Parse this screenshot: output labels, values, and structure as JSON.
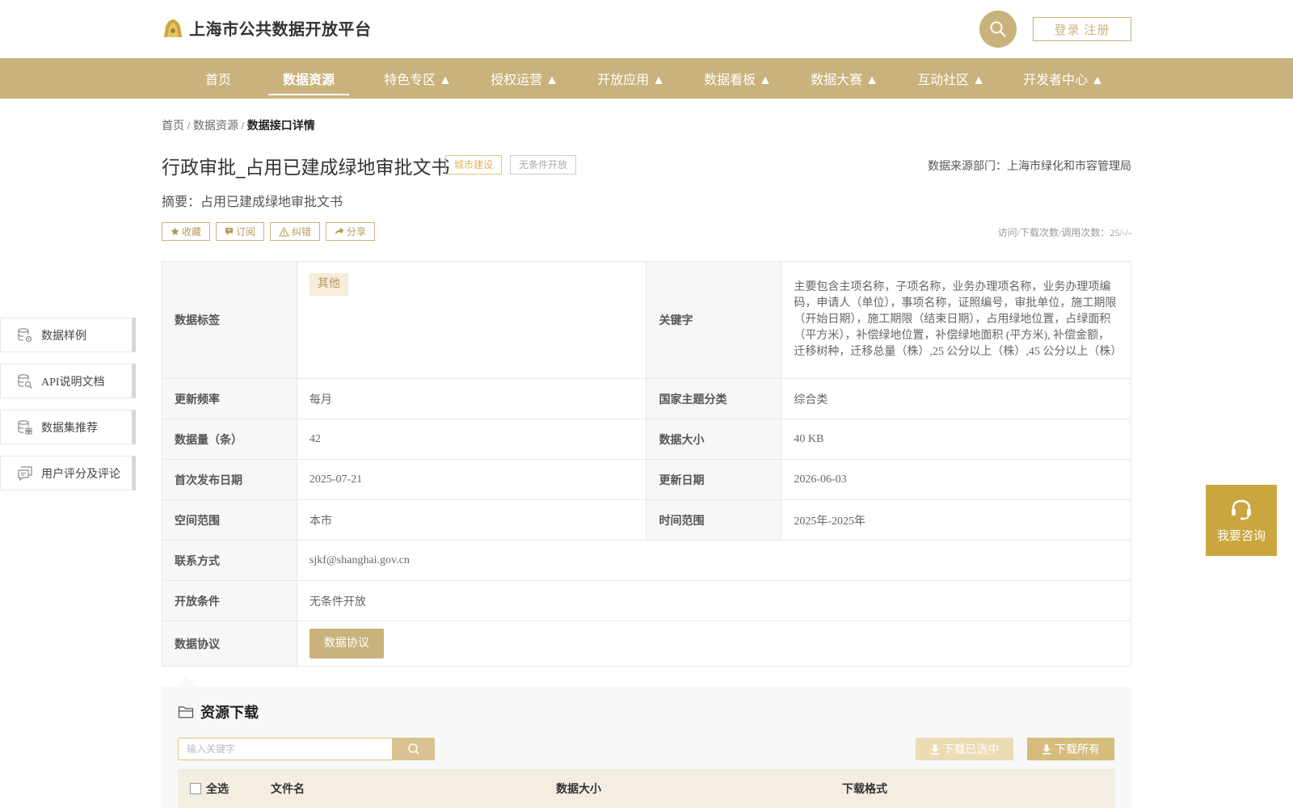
{
  "header": {
    "site_title": "上海市公共数据开放平台",
    "login_label": "登录 注册",
    "brand_color": "#c9b27c",
    "search_icon": "search-icon"
  },
  "nav": [
    {
      "label": "首页",
      "active": false
    },
    {
      "label": "数据资源",
      "active": true
    },
    {
      "label": "特色专区 ▲",
      "active": false
    },
    {
      "label": "授权运营 ▲",
      "active": false
    },
    {
      "label": "开放应用 ▲",
      "active": false
    },
    {
      "label": "数据看板 ▲",
      "active": false
    },
    {
      "label": "数据大赛 ▲",
      "active": false
    },
    {
      "label": "互动社区 ▲",
      "active": false
    },
    {
      "label": "开发者中心 ▲",
      "active": false
    }
  ],
  "breadcrumb": {
    "home": "首页",
    "sep": "/",
    "section": "数据资源",
    "current": "数据接口详情"
  },
  "dataset": {
    "title": "行政审批_占用已建成绿地审批文书",
    "tag_category": "城市建设",
    "tag_open": "无条件开放",
    "source_label": "数据来源部门：上海市绿化和市容管理局",
    "summary": "摘要：占用已建成绿地审批文书",
    "stats": "访问/下载次数/调用次数：25/-/-"
  },
  "actions": [
    {
      "label": "收藏",
      "icon": "star-icon"
    },
    {
      "label": "订阅",
      "icon": "subscribe-icon"
    },
    {
      "label": "纠错",
      "icon": "warning-icon"
    },
    {
      "label": "分享",
      "icon": "share-icon"
    }
  ],
  "info": {
    "tags_label": "数据标签",
    "tag_value": "其他",
    "keywords_label": "关键字",
    "keywords_value": "主要包含主项名称，子项名称，业务办理项名称，业务办理项编码，申请人（单位），事项名称，证照编号，审批单位，施工期限（开始日期），施工期限（结束日期），占用绿地位置，占绿面积（平方米），补偿绿地位置，补偿绿地面积 (平方米), 补偿金额，迁移树种，迁移总量（株）,25 公分以上（株）,45 公分以上（株）",
    "freq_label": "更新频率",
    "freq_value": "每月",
    "theme_label": "国家主题分类",
    "theme_value": "综合类",
    "count_label": "数据量（条）",
    "count_value": "42",
    "size_label": "数据大小",
    "size_value": "40 KB",
    "first_label": "首次发布日期",
    "first_value": "2025-07-21",
    "update_label": "更新日期",
    "update_value": "2026-06-03",
    "space_label": "空间范围",
    "space_value": "本市",
    "time_label": "时间范围",
    "time_value": "2025年-2025年",
    "contact_label": "联系方式",
    "contact_value": "sjkf@shanghai.gov.cn",
    "cond_label": "开放条件",
    "cond_value": "无条件开放",
    "protocol_label": "数据协议",
    "protocol_button": "数据协议"
  },
  "side_menu": [
    {
      "label": "数据样例",
      "icon": "database-settings-icon"
    },
    {
      "label": "API说明文档",
      "icon": "database-search-icon"
    },
    {
      "label": "数据集推荐",
      "icon": "database-grid-icon"
    },
    {
      "label": "用户评分及评论",
      "icon": "comment-icon"
    }
  ],
  "consult": {
    "label": "我要咨询",
    "icon": "headset-icon",
    "color": "#c9a63e"
  },
  "resources": {
    "title": "资源下载",
    "search_placeholder": "输入关键字",
    "download_selected": "下载已选中",
    "download_all": "下载所有",
    "select_all": "全选",
    "col_filename": "文件名",
    "col_size": "数据大小",
    "col_format": "下载格式"
  }
}
